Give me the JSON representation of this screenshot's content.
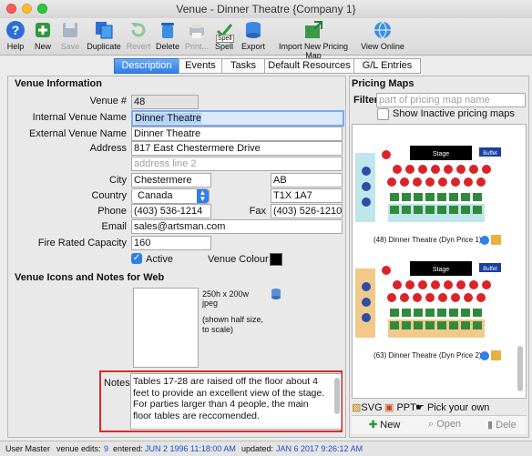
{
  "window": {
    "title": "Venue - Dinner Theatre {Company 1}"
  },
  "toolbar": {
    "help": "Help",
    "new": "New",
    "save": "Save",
    "duplicate": "Duplicate",
    "revert": "Revert",
    "delete": "Delete",
    "print": "Print...",
    "spell": "Spell",
    "spell_badge": "Spell",
    "export": "Export",
    "import_map": "Import New Pricing Map",
    "view_online": "View Online"
  },
  "tabs": [
    "Description",
    "Events",
    "Tasks",
    "Default Resources",
    "G/L Entries"
  ],
  "venue": {
    "section_title": "Venue Information",
    "venue_no_label": "Venue #",
    "venue_no": "48",
    "internal_name_label": "Internal Venue Name",
    "internal_name": "Dinner Theatre",
    "external_name_label": "External Venue Name",
    "external_name": "Dinner Theatre",
    "address_label": "Address",
    "address1": "817 East Chestermere Drive",
    "address2_placeholder": "address line 2",
    "city_label": "City",
    "city": "Chestermere",
    "province": "AB",
    "country_label": "Country",
    "country": "Canada",
    "postal": "T1X 1A7",
    "phone_label": "Phone",
    "phone": "(403) 536-1214",
    "fax_label": "Fax",
    "fax": "(403) 526-1210",
    "email_label": "Email",
    "email": "sales@artsman.com",
    "fire_label": "Fire Rated Capacity",
    "fire": "160",
    "active_label": "Active",
    "colour_label": "Venue Colour",
    "colour": "#000000"
  },
  "icons_notes": {
    "section_title": "Venue Icons and Notes for Web",
    "size_text": "250h x 200w",
    "format_text": "jpeg",
    "scale_text": "(shown half size, to scale)",
    "notes_label": "Notes",
    "notes": "Tables 17-28 are raised off the floor about 4 feet to provide an excellent view of the stage.  For parties larger than 4 people, the main floor tables are reccomended."
  },
  "pricing_maps": {
    "title": "Pricing Maps",
    "filter_label": "Filter",
    "filter_placeholder": "part of pricing map name",
    "show_inactive": "Show Inactive pricing maps",
    "maps": [
      {
        "caption": "(48) Dinner Theatre (Dyn Price 1)",
        "stage": "Stage",
        "buffet": "Buffet"
      },
      {
        "caption": "(63) Dinner Theatre (Dyn Price 2)",
        "stage": "Stage",
        "buffet": "Buffet"
      }
    ],
    "svg_label": "SVG",
    "ppt_label": "PPT",
    "pick_label": "Pick your own",
    "new_button": "New",
    "open_button": "Open",
    "delete_button": "Dele"
  },
  "status": {
    "user": "User Master",
    "edits_label": "venue edits:",
    "edits": "9",
    "entered_label": "entered:",
    "entered": "JUN 2 1996 11:18:00 AM",
    "updated_label": "updated:",
    "updated": "JAN 6 2017 9:26:12 AM"
  }
}
